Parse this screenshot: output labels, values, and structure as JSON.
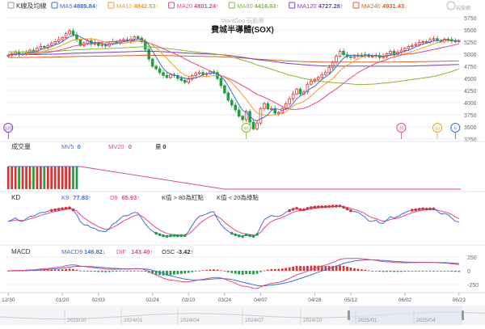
{
  "brand": {
    "name": "WantGoo 玩股網",
    "logo_text": "玩股網"
  },
  "chart_data": {
    "type": "line",
    "title": "費城半導體(SOX)",
    "price_panel": {
      "legend_title": "K線及均線",
      "legend": [
        {
          "name": "MA5",
          "value": "4889.84↑",
          "color": "#3b6fd6"
        },
        {
          "name": "MA10",
          "value": "4842.53↑",
          "color": "#f0a020"
        },
        {
          "name": "MA20",
          "value": "4801.24↑",
          "color": "#e04a8a"
        },
        {
          "name": "MA60",
          "value": "4416.63↑",
          "color": "#88b830"
        },
        {
          "name": "MA120",
          "value": "4727.28↑",
          "color": "#7a3fc0"
        },
        {
          "name": "MA240",
          "value": "4931.43↓",
          "color": "#e06020"
        }
      ],
      "ylim": [
        3250,
        5750
      ],
      "yticks": [
        3250,
        3500,
        3750,
        4000,
        4250,
        4500,
        4750,
        5000,
        5250,
        5500,
        5750
      ],
      "markers": [
        {
          "label": "120",
          "color": "#7a3fc0",
          "index": 0
        },
        {
          "label": "60",
          "color": "#88b830",
          "index": 66
        },
        {
          "label": "20",
          "color": "#e04a8a",
          "index": 109
        },
        {
          "label": "10",
          "color": "#f0a020",
          "index": 119
        },
        {
          "label": "5",
          "color": "#3b6fd6",
          "index": 124
        }
      ]
    },
    "volume_panel": {
      "legend_title": "成交量",
      "legend": [
        {
          "name": "MV5",
          "value": "0",
          "color": "#3b6fd6"
        },
        {
          "name": "MV20",
          "value": "0",
          "color": "#e04a8a"
        },
        {
          "name": "量",
          "value": "0",
          "color": "#333333"
        }
      ]
    },
    "kd_panel": {
      "legend_title": "KD",
      "legend": [
        {
          "name": "K9",
          "value": "77.83↑",
          "color": "#3b6fd6"
        },
        {
          "name": "D9",
          "value": "65.93↑",
          "color": "#e04a8a"
        },
        {
          "name": "K值 > 80為紅點",
          "value": "",
          "color": "#333333"
        },
        {
          "name": "K值 < 20為綠點",
          "value": "",
          "color": "#333333"
        }
      ]
    },
    "macd_panel": {
      "legend_title": "MACD",
      "legend": [
        {
          "name": "MACD9",
          "value": "146.82↓",
          "color": "#3b6fd6"
        },
        {
          "name": "DIF",
          "value": "143.40↑",
          "color": "#e04a8a"
        },
        {
          "name": "OSC",
          "value": "-3.42↑",
          "color": "#333333"
        }
      ],
      "yticks": [
        -250,
        0,
        250
      ]
    },
    "x_axis": {
      "labels": [
        "12/30",
        "01/20",
        "02/03",
        "02/24",
        "03/10",
        "03/24",
        "04/07",
        "04/28",
        "05/12",
        "06/02",
        "06/23"
      ],
      "label_index": [
        0,
        15,
        25,
        40,
        50,
        60,
        70,
        85,
        95,
        110,
        125
      ],
      "navigator_labels": [
        "2023/10",
        "2024/01",
        "2024/04",
        "2024/07",
        "2024/10",
        "2025/01",
        "2025/04"
      ]
    },
    "closes": [
      4980,
      5010,
      5040,
      4990,
      5005,
      5050,
      5080,
      5060,
      5120,
      5160,
      5140,
      5180,
      5220,
      5260,
      5300,
      5340,
      5420,
      5480,
      5400,
      5300,
      5180,
      5230,
      5280,
      5210,
      5240,
      5180,
      5200,
      5170,
      5220,
      5260,
      5240,
      5280,
      5300,
      5270,
      5310,
      5360,
      5330,
      5260,
      5100,
      4900,
      4750,
      4700,
      4620,
      4560,
      4520,
      4580,
      4560,
      4500,
      4460,
      4420,
      4500,
      4560,
      4600,
      4620,
      4580,
      4600,
      4640,
      4620,
      4500,
      4350,
      4200,
      4050,
      3950,
      3850,
      3720,
      3650,
      3820,
      3600,
      3460,
      3580,
      3880,
      3980,
      3870,
      3880,
      3780,
      3800,
      3880,
      3980,
      4080,
      4180,
      4280,
      4180,
      4220,
      4380,
      4440,
      4480,
      4520,
      4580,
      4620,
      4720,
      4840,
      4960,
      5060,
      4990,
      4950,
      4930,
      4960,
      4980,
      4970,
      4990,
      4950,
      4960,
      4975,
      4930,
      4950,
      5010,
      5060,
      5000,
      5040,
      5080,
      5120,
      5160,
      5180,
      5200,
      5240,
      5260,
      5250,
      5300,
      5320,
      5280,
      5260,
      5310,
      5300,
      5270,
      5260,
      5280
    ]
  }
}
